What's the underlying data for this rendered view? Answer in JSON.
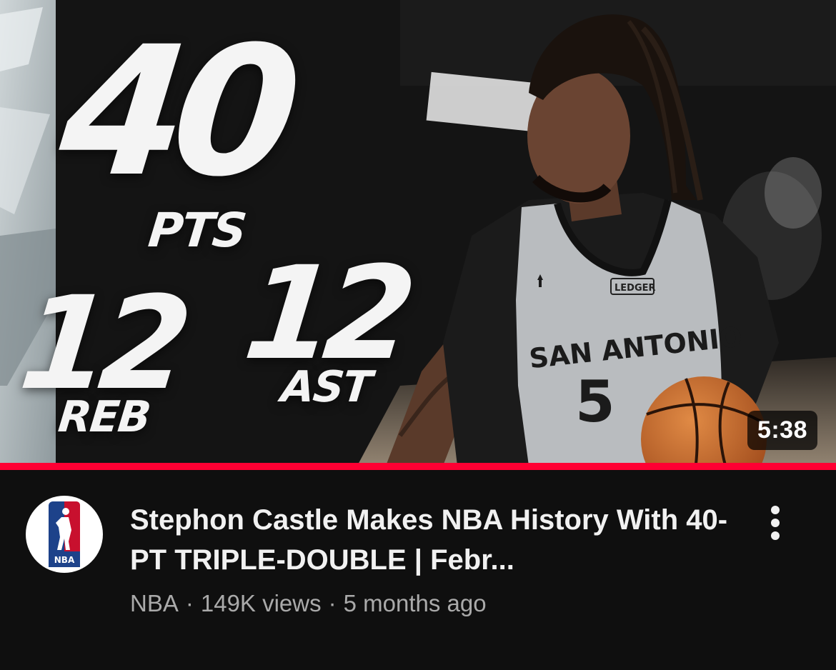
{
  "thumbnail": {
    "stats": {
      "points_value": "40",
      "points_label": "PTS",
      "rebounds_value": "12",
      "rebounds_label": "REB",
      "assists_value": "12",
      "assists_label": "AST"
    },
    "jersey": {
      "team_text": "SAN ANTONIO",
      "number": "5",
      "sponsor": "LEDGER"
    },
    "duration": "5:38",
    "watch_progress_fraction": 1.0
  },
  "video": {
    "title": "Stephon Castle Makes NBA History With 40-PT TRIPLE-DOUBLE | Febr...",
    "channel": "NBA",
    "views": "149K views",
    "age": "5 months ago",
    "separator": "·"
  },
  "channel_logo": {
    "text": "NBA",
    "colors": {
      "blue": "#1d428a",
      "red": "#c8102e",
      "white": "#ffffff"
    }
  },
  "colors": {
    "background": "#0f0f0f",
    "progress": "#ff0033",
    "title_text": "#f1f1f1",
    "meta_text": "#aaaaaa"
  },
  "icons": {
    "menu": "more-vertical-icon"
  }
}
